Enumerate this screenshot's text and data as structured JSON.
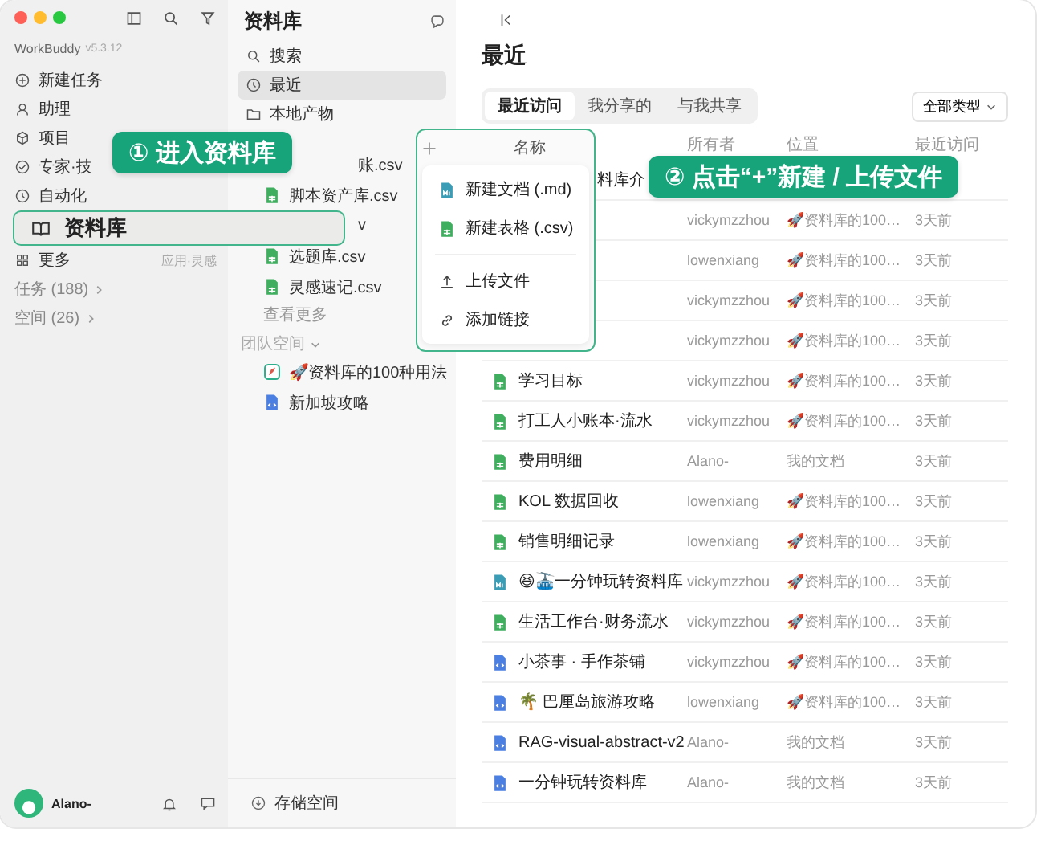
{
  "sidebar": {
    "app_name": "WorkBuddy",
    "version": "v5.3.12",
    "items": [
      {
        "label": "新建任务"
      },
      {
        "label": "助理"
      },
      {
        "label": "项目"
      },
      {
        "label": "专家·技"
      },
      {
        "label": "自动化"
      },
      {
        "label": "更多",
        "note": "应用·灵感"
      }
    ],
    "sections": [
      "任务 (188)",
      "空间 (26)"
    ],
    "user": "Alano-"
  },
  "library": {
    "title": "资料库",
    "nav": [
      {
        "label": "搜索",
        "selected": false
      },
      {
        "label": "最近",
        "selected": true
      },
      {
        "label": "本地产物",
        "selected": false
      }
    ],
    "files": [
      {
        "name": "账.csv",
        "kind": "cut"
      },
      {
        "name": "脚本资产库.csv",
        "kind": "csv"
      },
      {
        "name": "v",
        "kind": "cut"
      },
      {
        "name": "选题库.csv",
        "kind": "csv"
      },
      {
        "name": "灵感速记.csv",
        "kind": "csv"
      }
    ],
    "more": "查看更多",
    "team_header": "团队空间",
    "team": [
      {
        "name": "🚀资料库的100种用法",
        "kind": "space"
      },
      {
        "name": "新加坡攻略",
        "kind": "doc"
      }
    ],
    "storage": "存储空间"
  },
  "main": {
    "title": "最近",
    "tabs": [
      {
        "label": "最近访问",
        "selected": true
      },
      {
        "label": "我分享的",
        "selected": false
      },
      {
        "label": "与我共享",
        "selected": false
      }
    ],
    "filter": "全部类型",
    "columns": [
      "所有者",
      "位置",
      "最近访问"
    ],
    "rows": [
      {
        "name": "料库介",
        "kind": "cut"
      },
      {
        "owner": "vickymzzhou",
        "location": "🚀资料库的100…",
        "time": "3天前"
      },
      {
        "owner": "lowenxiang",
        "location": "🚀资料库的100…",
        "time": "3天前"
      },
      {
        "owner": "vickymzzhou",
        "location": "🚀资料库的100…",
        "time": "3天前"
      },
      {
        "owner": "vickymzzhou",
        "location": "🚀资料库的100…",
        "time": "3天前"
      },
      {
        "name": "学习目标",
        "kind": "csv",
        "owner": "vickymzzhou",
        "location": "🚀资料库的100…",
        "time": "3天前"
      },
      {
        "name": "打工人小账本·流水",
        "kind": "csv",
        "owner": "vickymzzhou",
        "location": "🚀资料库的100…",
        "time": "3天前"
      },
      {
        "name": "费用明细",
        "kind": "csv",
        "owner": "Alano-",
        "location": "我的文档",
        "time": "3天前"
      },
      {
        "name": "KOL 数据回收",
        "kind": "csv",
        "owner": "lowenxiang",
        "location": "🚀资料库的100…",
        "time": "3天前"
      },
      {
        "name": "销售明细记录",
        "kind": "csv",
        "owner": "lowenxiang",
        "location": "🚀资料库的100…",
        "time": "3天前"
      },
      {
        "name": "😆🚠一分钟玩转资料库",
        "kind": "md",
        "owner": "vickymzzhou",
        "location": "🚀资料库的100…",
        "time": "3天前"
      },
      {
        "name": "生活工作台·财务流水",
        "kind": "csv",
        "owner": "vickymzzhou",
        "location": "🚀资料库的100…",
        "time": "3天前"
      },
      {
        "name": "小茶事 · 手作茶铺",
        "kind": "doc",
        "owner": "vickymzzhou",
        "location": "🚀资料库的100…",
        "time": "3天前"
      },
      {
        "name": "🌴 巴厘岛旅游攻略",
        "kind": "doc",
        "owner": "lowenxiang",
        "location": "🚀资料库的100…",
        "time": "3天前"
      },
      {
        "name": "RAG-visual-abstract-v2",
        "kind": "doc",
        "owner": "Alano-",
        "location": "我的文档",
        "time": "3天前"
      },
      {
        "name": "一分钟玩转资料库",
        "kind": "doc",
        "owner": "Alano-",
        "location": "我的文档",
        "time": "3天前"
      }
    ]
  },
  "menu": {
    "header": "名称",
    "items": [
      {
        "label": "新建文档 (.md)",
        "kind": "md"
      },
      {
        "label": "新建表格 (.csv)",
        "kind": "csv"
      },
      {
        "label": "上传文件",
        "kind": "upload"
      },
      {
        "label": "添加链接",
        "kind": "link"
      }
    ]
  },
  "callouts": {
    "step1": "① 进入资料库",
    "highlight": "资料库",
    "step2": "② 点击“+”新建 / 上传文件"
  }
}
